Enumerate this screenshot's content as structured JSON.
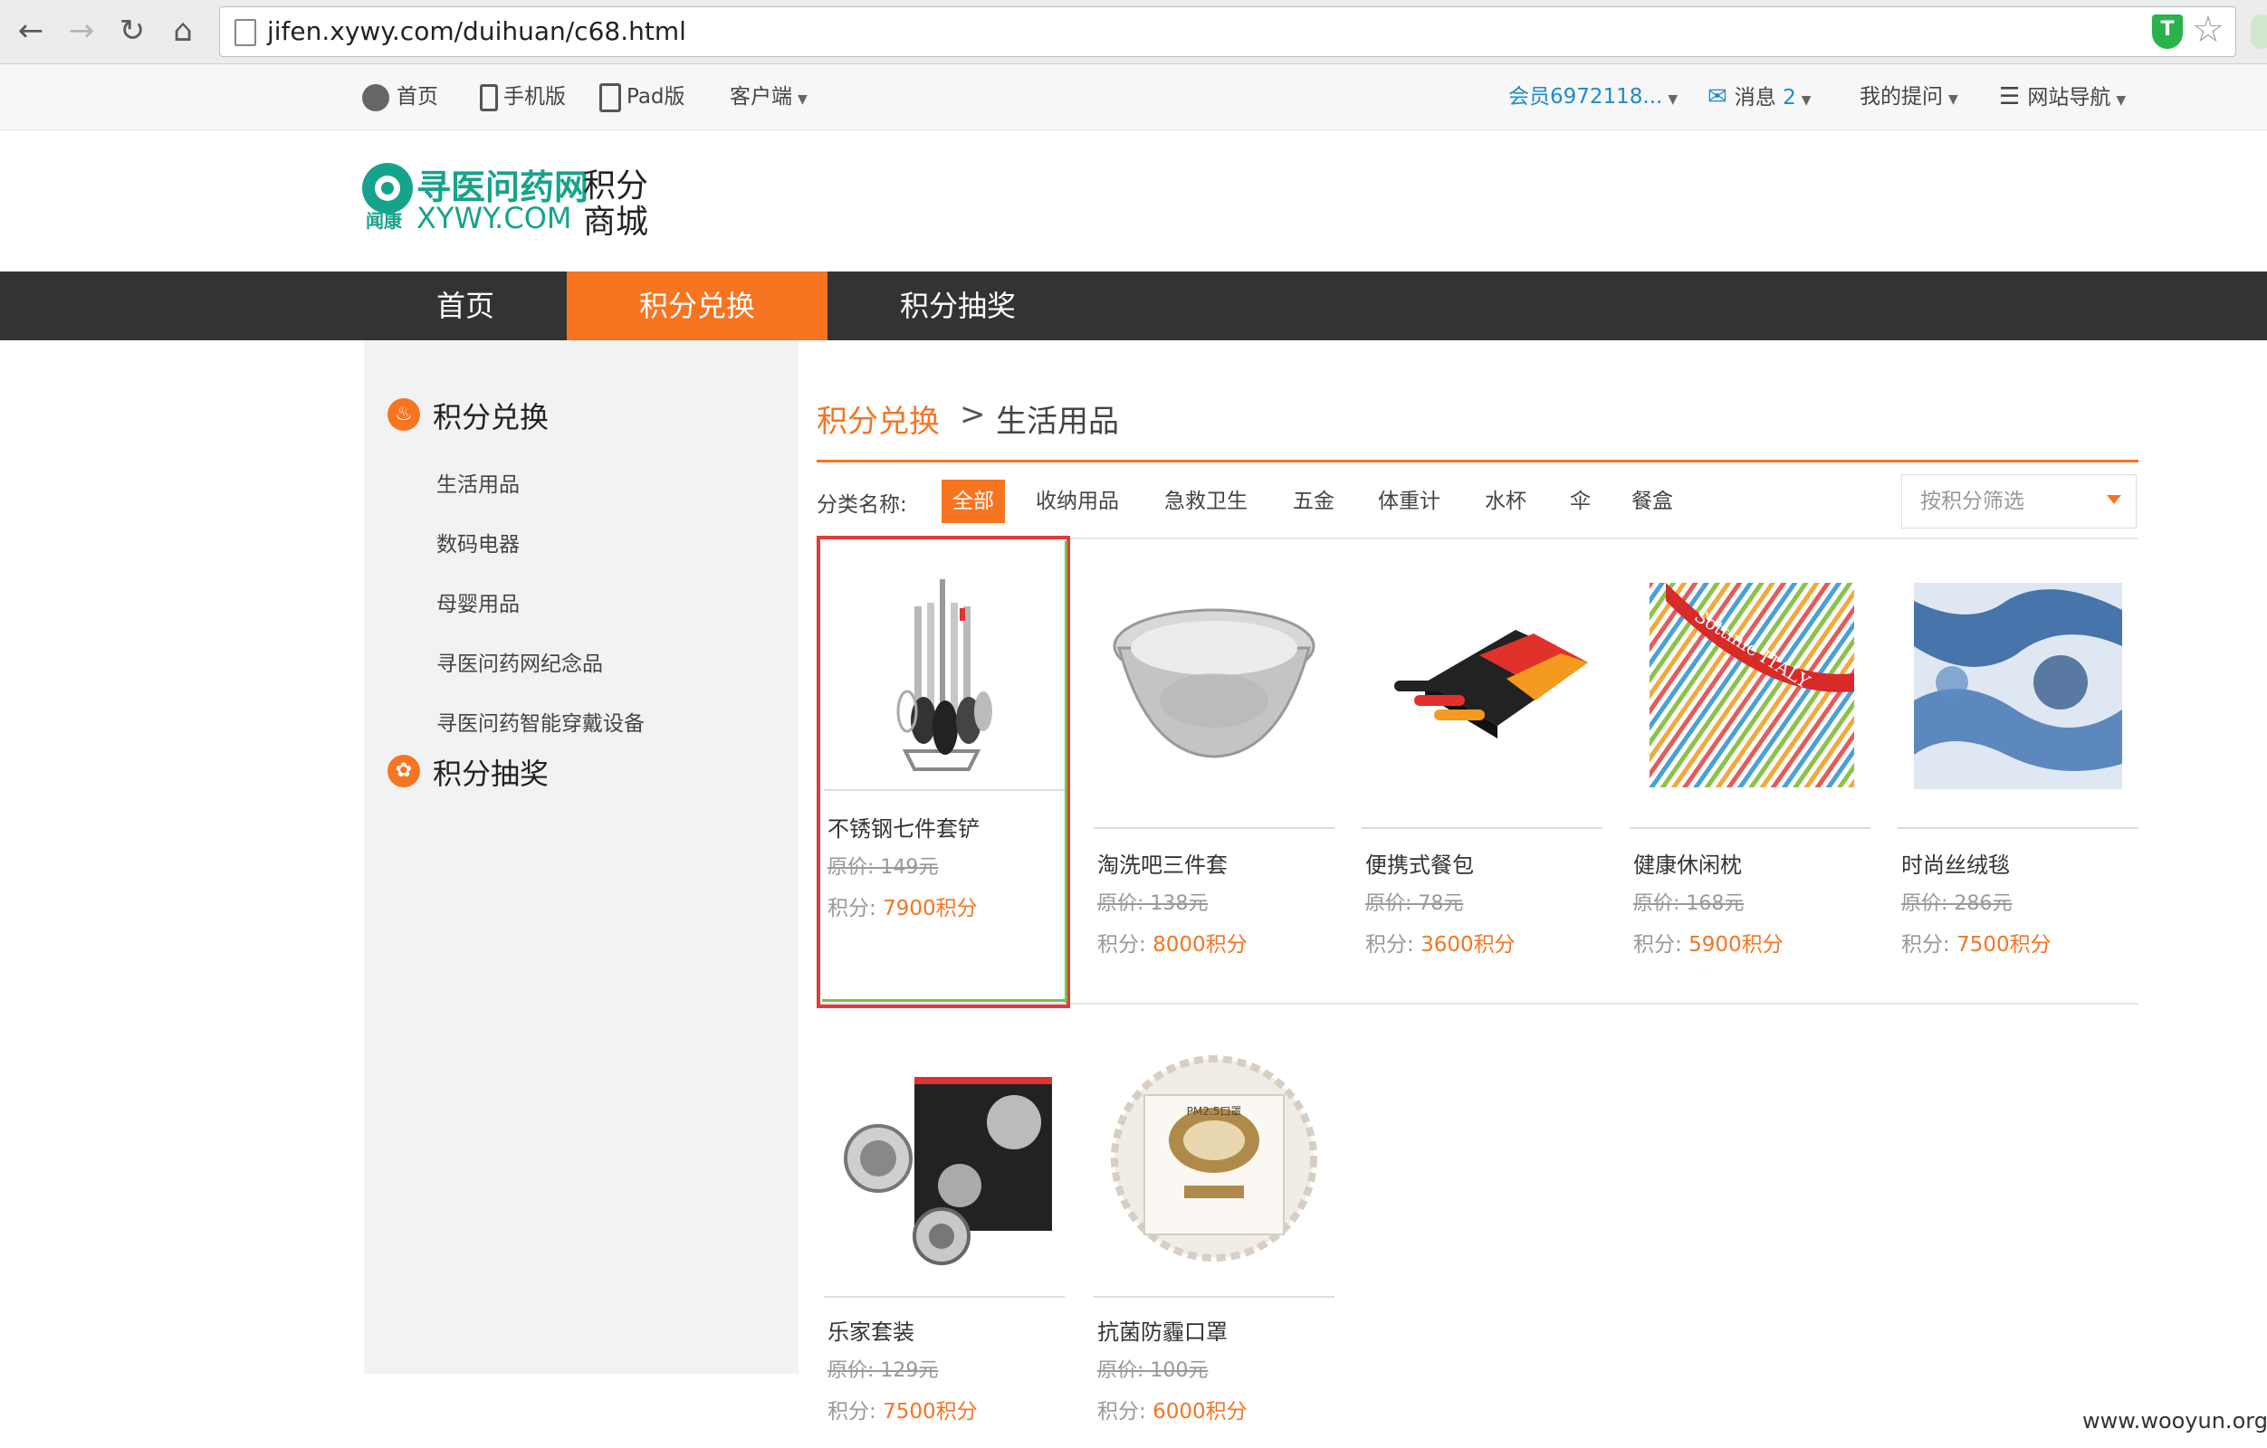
{
  "browser": {
    "url": "jifen.xywy.com/duihuan/c68.html"
  },
  "topbar": {
    "home": "首页",
    "mobile": "手机版",
    "pad": "Pad版",
    "client": "客户端",
    "member": "会员6972118...",
    "messages_label": "消息",
    "messages_count": "2",
    "my_questions": "我的提问",
    "site_nav": "网站导航"
  },
  "header": {
    "logo_cn": "寻医问药网",
    "logo_sub": "闻康",
    "logo_en": "XYWY.COM",
    "title_line1": "积分",
    "title_line2": "商城"
  },
  "mainnav": {
    "items": [
      "首页",
      "积分兑换",
      "积分抽奖"
    ],
    "active_index": 1
  },
  "sidebar": {
    "section1": "积分兑换",
    "items": [
      "生活用品",
      "数码电器",
      "母婴用品",
      "寻医问药网纪念品",
      "寻医问药智能穿戴设备"
    ],
    "section2": "积分抽奖"
  },
  "breadcrumb": {
    "root": "积分兑换",
    "sep": ">",
    "current": "生活用品"
  },
  "categories": {
    "label": "分类名称:",
    "items": [
      "全部",
      "收纳用品",
      "急救卫生",
      "五金",
      "体重计",
      "水杯",
      "伞",
      "餐盒"
    ],
    "active_index": 0
  },
  "filter": {
    "placeholder": "按积分筛选"
  },
  "products": [
    {
      "name": "不锈钢七件套铲",
      "orig": "原价:  149元",
      "pts_label": "积分:",
      "pts": "7900积分"
    },
    {
      "name": "淘洗吧三件套",
      "orig": "原价:  138元",
      "pts_label": "积分:",
      "pts": "8000积分"
    },
    {
      "name": "便携式餐包",
      "orig": "原价:  78元",
      "pts_label": "积分:",
      "pts": "3600积分"
    },
    {
      "name": "健康休闲枕",
      "orig": "原价:  168元",
      "pts_label": "积分:",
      "pts": "5900积分"
    },
    {
      "name": "时尚丝绒毯",
      "orig": "原价:  286元",
      "pts_label": "积分:",
      "pts": "7500积分"
    },
    {
      "name": "乐家套装",
      "orig": "原价:  129元",
      "pts_label": "积分:",
      "pts": "7500积分"
    },
    {
      "name": "抗菌防霾口罩",
      "orig": "原价:  100元",
      "pts_label": "积分:",
      "pts": "6000积分"
    }
  ],
  "pillow_text": "Sottinie ITALY",
  "mask_text": "PM2.5口罩",
  "watermark": "www.wooyun.org"
}
